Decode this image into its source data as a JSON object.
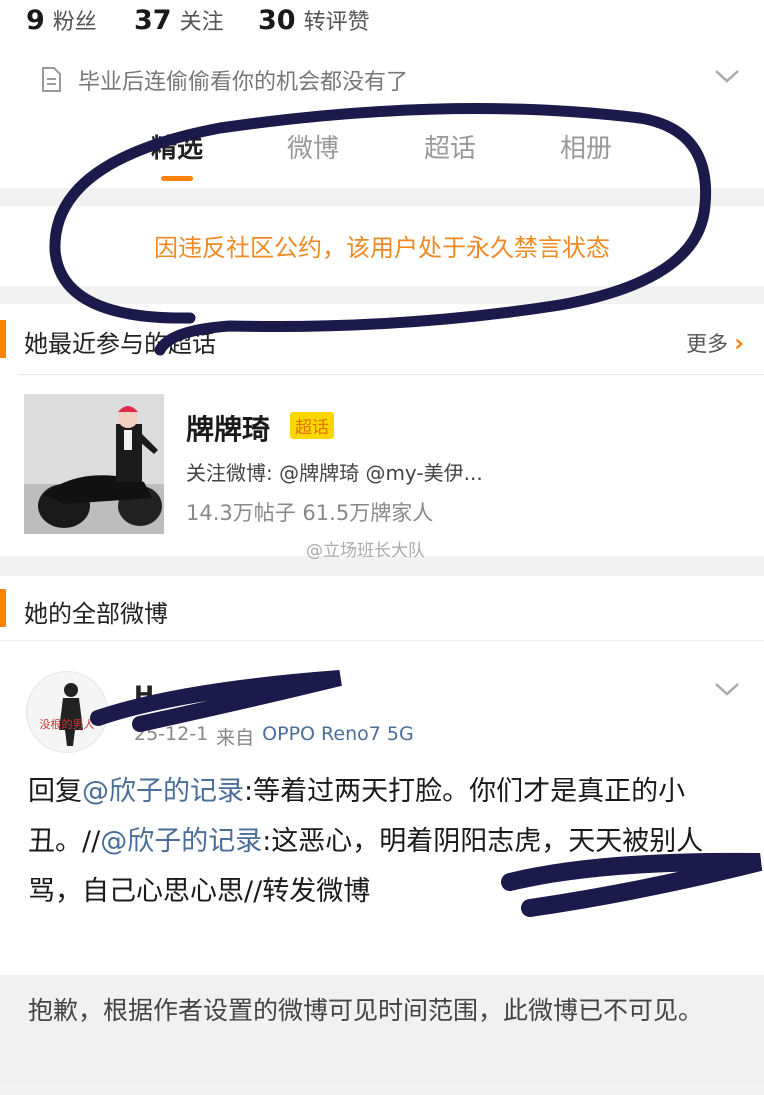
{
  "stats": [
    {
      "value": "9",
      "label": "粉丝"
    },
    {
      "value": "37",
      "label": "关注"
    },
    {
      "value": "30",
      "label": "转评赞"
    }
  ],
  "bio": {
    "text": "毕业后连偷偷看你的机会都没有了",
    "icon": "document-icon",
    "expand_icon": "chevron-down-icon"
  },
  "tabs": [
    {
      "label": "精选",
      "active": true
    },
    {
      "label": "微博",
      "active": false
    },
    {
      "label": "超话",
      "active": false
    },
    {
      "label": "相册",
      "active": false
    }
  ],
  "ban_notice": "因违反社区公约，该用户处于永久禁言状态",
  "super_topics": {
    "title": "她最近参与的超话",
    "more_label": "更多",
    "item": {
      "name": "牌牌琦",
      "badge": "超话",
      "follow": "关注微博: @牌牌琦 @my-美伊...",
      "stats": "14.3万帖子 61.5万牌家人"
    }
  },
  "watermark": "@立场班长大队",
  "posts": {
    "title": "她的全部微博",
    "post": {
      "username": "H",
      "avatar_text": "没根的男人",
      "date": "25-12-1",
      "source_prefix": "来自",
      "device": "OPPO Reno7 5G",
      "body": {
        "p1": "回复",
        "m1": "@欣子的记录",
        "p2": ":等着过两天打脸。你们才是真正的小丑。//",
        "m2": "@欣子的记录",
        "p3": ":这恶心，明着阴阳志虎，天天被别人骂，自己心思心思//",
        "p4": "转发微博"
      }
    },
    "hidden_notice": "抱歉，根据作者设置的微博可见时间范围，此微博已不可见。"
  },
  "colors": {
    "accent": "#ff8200",
    "ban_text": "#f08a24",
    "link": "#4a6d9a",
    "scribble": "#1b1a4a"
  }
}
